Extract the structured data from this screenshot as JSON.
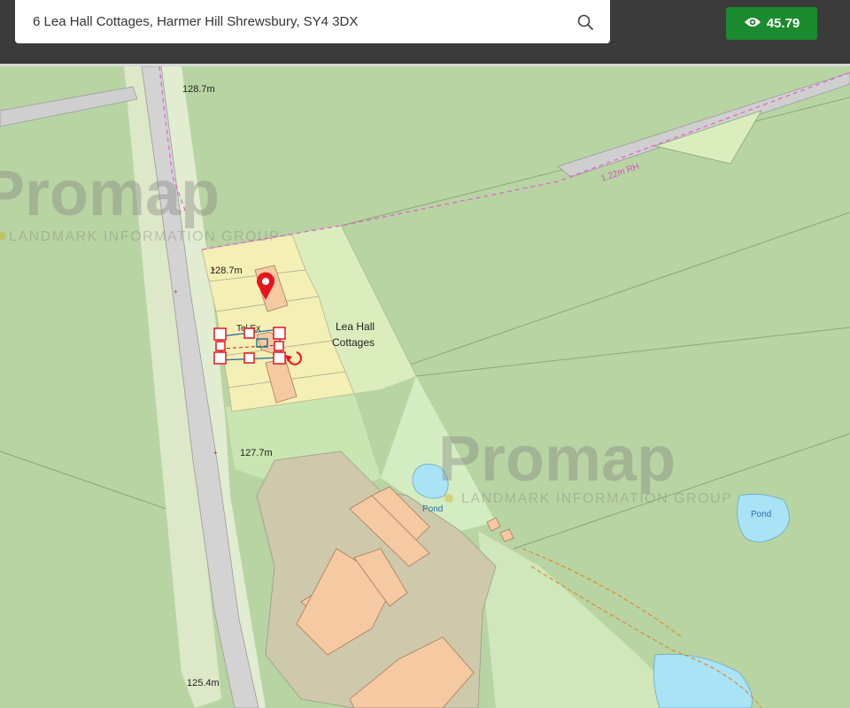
{
  "search": {
    "value": "6 Lea Hall Cottages, Harmer Hill Shrewsbury, SY4 3DX",
    "icon": "search-icon"
  },
  "views": {
    "icon": "eye-icon",
    "count": "45.79",
    "color": "#1c8a2e"
  },
  "map": {
    "labels": {
      "height_top": "128.7m",
      "height_cottage": "128.7m",
      "height_mid": "127.7m",
      "height_bottom": "125.4m",
      "rail": "1.22m RH",
      "tel_ex": "Tel Ex",
      "place_line1": "Lea Hall",
      "place_line2": "Cottages",
      "pond_left": "Pond",
      "pond_right": "Pond"
    },
    "watermark": {
      "brand": "Promap",
      "tagline": "LANDMARK INFORMATION GROUP"
    },
    "colors": {
      "field": "#b8d4a3",
      "plot": "#f4efb4",
      "building": "#f5c9a2",
      "water": "#a9e3f5",
      "road": "#d3d3d3",
      "marker": "#e8141b"
    }
  }
}
